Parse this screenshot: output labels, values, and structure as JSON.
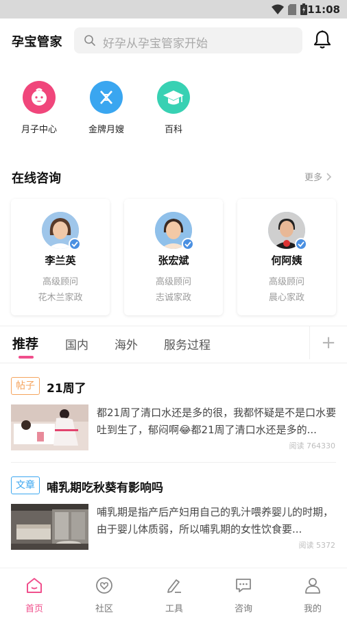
{
  "status_bar": {
    "time": "11:08"
  },
  "header": {
    "app_title": "孕宝管家",
    "search_placeholder": "好孕从孕宝管家开始"
  },
  "categories": [
    {
      "label": "月子中心",
      "icon": "baby-face-icon",
      "color": "#f0467b"
    },
    {
      "label": "金牌月嫂",
      "icon": "dna-strand-icon",
      "color": "#3aa6f0"
    },
    {
      "label": "百科",
      "icon": "graduation-cap-icon",
      "color": "#38d1b3"
    }
  ],
  "consult": {
    "title": "在线咨询",
    "more_label": "更多",
    "advisors": [
      {
        "name": "李兰英",
        "role": "高级顾问",
        "company": "花木兰家政"
      },
      {
        "name": "张宏斌",
        "role": "高级顾问",
        "company": "志诚家政"
      },
      {
        "name": "何阿姨",
        "role": "高级顾问",
        "company": "晨心家政"
      }
    ]
  },
  "tabs": [
    {
      "label": "推荐",
      "active": true
    },
    {
      "label": "国内",
      "active": false
    },
    {
      "label": "海外",
      "active": false
    },
    {
      "label": "服务过程",
      "active": false
    }
  ],
  "tab_add_label": "+",
  "posts": [
    {
      "tag": "帖子",
      "tag_color": "#f5a35c",
      "title": "21周了",
      "excerpt": "都21周了清口水还是多的很，我都怀疑是不是口水要吐到生了，郁闷啊😂都21周了清口水还是多的...",
      "reads": "阅读 764330"
    },
    {
      "tag": "文章",
      "tag_color": "#3aa6f0",
      "title": "哺乳期吃秋葵有影响吗",
      "excerpt": "哺乳期是指产后产妇用自己的乳汁喂养婴儿的时期，由于婴儿体质弱，所以哺乳期的女性饮食要...",
      "reads": "阅读 5372"
    }
  ],
  "bottom_nav": [
    {
      "label": "首页",
      "icon": "home-icon",
      "active": true
    },
    {
      "label": "社区",
      "icon": "community-heart-icon",
      "active": false
    },
    {
      "label": "工具",
      "icon": "tools-pen-icon",
      "active": false
    },
    {
      "label": "咨询",
      "icon": "chat-bubble-icon",
      "active": false
    },
    {
      "label": "我的",
      "icon": "profile-icon",
      "active": false
    }
  ],
  "colors": {
    "accent": "#f04f8c",
    "verify": "#4a90e2"
  }
}
